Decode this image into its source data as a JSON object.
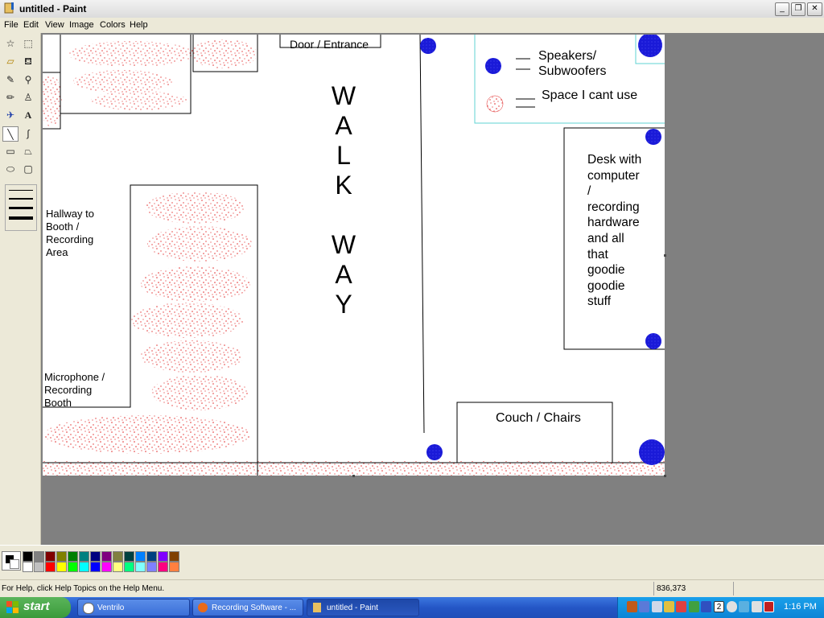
{
  "window": {
    "title": "untitled - Paint"
  },
  "menu": [
    "File",
    "Edit",
    "View",
    "Image",
    "Colors",
    "Help"
  ],
  "tools": [
    "free-select",
    "rect-select",
    "eraser",
    "fill",
    "color-picker",
    "magnifier",
    "pencil",
    "brush",
    "airbrush",
    "text",
    "line",
    "curve",
    "rectangle",
    "polygon",
    "ellipse",
    "rounded-rect"
  ],
  "canvas": {
    "door_label": "Door / Entrance",
    "walkway_letters": [
      "W",
      "A",
      "L",
      "K",
      "",
      "W",
      "A",
      "Y"
    ],
    "legend": {
      "speakers": "Speakers/\nSubwoofers",
      "space": "Space I cant use"
    },
    "desk_label": "Desk with\ncomputer\n/\nrecording\nhardware\nand all\nthat\ngoodie\ngoodie\nstuff",
    "hallway_label": "Hallway to\nBooth /\nRecording\nArea",
    "booth_label": "Microphone /\nRecording\nBooth",
    "couch_label": "Couch / Chairs",
    "colors": {
      "speaker": "#1a1ad8",
      "unusable": "#e02020",
      "legend_box": "#5fd3d3"
    }
  },
  "palette": [
    "#000000",
    "#808080",
    "#800000",
    "#808000",
    "#008000",
    "#008080",
    "#000080",
    "#800080",
    "#808040",
    "#004040",
    "#0080ff",
    "#004080",
    "#8000ff",
    "#804000",
    "#ffffff",
    "#c0c0c0",
    "#ff0000",
    "#ffff00",
    "#00ff00",
    "#00ffff",
    "#0000ff",
    "#ff00ff",
    "#ffff80",
    "#00ff80",
    "#80ffff",
    "#8080ff",
    "#ff0080",
    "#ff8040"
  ],
  "status": {
    "help": "For Help, click Help Topics on the Help Menu.",
    "coords": "836,373"
  },
  "taskbar": {
    "start": "start",
    "tasks": [
      "Ventrilo",
      "Recording Software - ...",
      "untitled - Paint"
    ],
    "tray_badge": "2",
    "clock": "1:16 PM"
  }
}
